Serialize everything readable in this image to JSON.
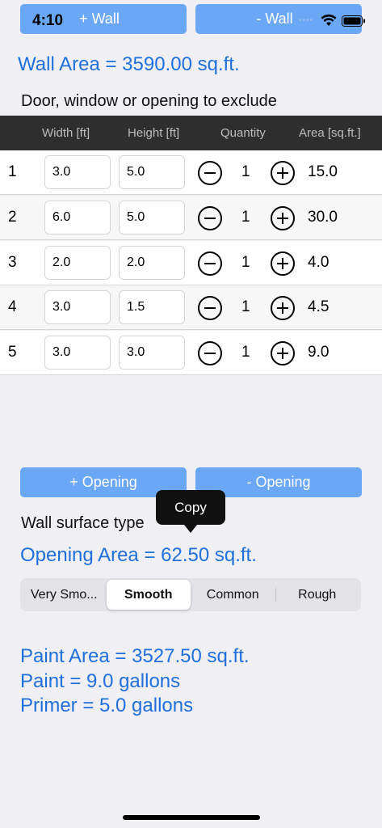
{
  "status": {
    "time": "4:10"
  },
  "wall_buttons": {
    "add": "+ Wall",
    "remove": "- Wall"
  },
  "wall_area": "Wall Area = 3590.00 sq.ft.",
  "exclude_label": "Door, window or opening to exclude",
  "table": {
    "headers": [
      "Width [ft]",
      "Height [ft]",
      "Quantity",
      "Area [sq.ft.]"
    ],
    "rows": [
      {
        "idx": "1",
        "width": "3.0",
        "height": "5.0",
        "qty": "1",
        "area": "15.0"
      },
      {
        "idx": "2",
        "width": "6.0",
        "height": "5.0",
        "qty": "1",
        "area": "30.0"
      },
      {
        "idx": "3",
        "width": "2.0",
        "height": "2.0",
        "qty": "1",
        "area": "4.0"
      },
      {
        "idx": "4",
        "width": "3.0",
        "height": "1.5",
        "qty": "1",
        "area": "4.5"
      },
      {
        "idx": "5",
        "width": "3.0",
        "height": "3.0",
        "qty": "1",
        "area": "9.0"
      }
    ]
  },
  "opening_buttons": {
    "add": "+ Opening",
    "remove": "- Opening"
  },
  "copy_tooltip": "Copy",
  "surface_label": "Wall surface type",
  "opening_area": "Opening Area = 62.50 sq.ft.",
  "surface_types": [
    "Very Smo...",
    "Smooth",
    "Common",
    "Rough"
  ],
  "selected_surface": "Smooth",
  "results": {
    "paint_area": "Paint Area = 3527.50 sq.ft.",
    "paint": "Paint = 9.0 gallons",
    "primer": "Primer = 5.0 gallons"
  }
}
